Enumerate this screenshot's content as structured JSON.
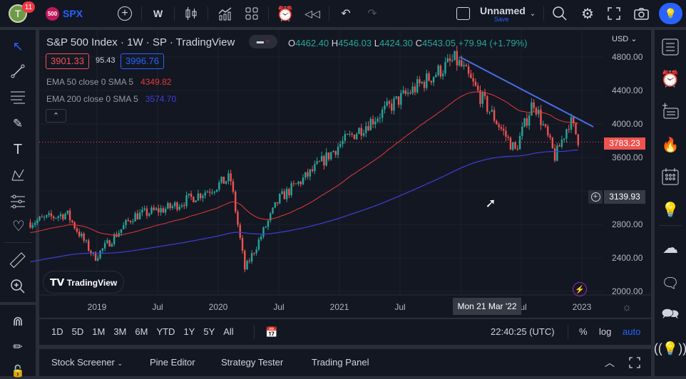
{
  "topbar": {
    "avatar_letter": "T",
    "notifications": "11",
    "symbol_badge": "500",
    "symbol": "SPX",
    "interval": "W",
    "layout_name": "Unnamed",
    "save_label": "Save"
  },
  "legend": {
    "title": "S&P 500 Index · 1W · SP  · TradingView",
    "o_label": "O",
    "open": "4462.40",
    "h_label": "H",
    "high": "4546.03",
    "l_label": "L",
    "low": "4424.30",
    "c_label": "C",
    "close": "4543.05",
    "change": "+79.94 (+1.79%)",
    "bid": "3901.33",
    "spread": "95.43",
    "ask": "3996.76",
    "ema50_label": "EMA 50 close 0 SMA 5",
    "ema50_value": "4349.82",
    "ema200_label": "EMA 200 close 0 SMA 5",
    "ema200_value": "3574.70"
  },
  "price_axis": {
    "currency": "USD",
    "ticks": [
      "4800.00",
      "4400.00",
      "4000.00",
      "3600.00",
      "2800.00",
      "2400.00",
      "2000.00"
    ],
    "last_price": "3783.23",
    "crosshair_price": "3139.93"
  },
  "time_axis": {
    "ticks": [
      "2019",
      "Jul",
      "2020",
      "Jul",
      "2021",
      "Jul",
      "Jul",
      "2023"
    ],
    "crosshair_date": "Mon 21 Mar '22"
  },
  "watermark": "TradingView",
  "range_bar": {
    "ranges": [
      "1D",
      "5D",
      "1M",
      "3M",
      "6M",
      "YTD",
      "1Y",
      "5Y",
      "All"
    ],
    "clock": "22:40:25 (UTC)",
    "percent": "%",
    "log": "log",
    "auto": "auto"
  },
  "bottom_tabs": [
    "Stock Screener",
    "Pine Editor",
    "Strategy Tester",
    "Trading Panel"
  ],
  "colors": {
    "up": "#26a69a",
    "down": "#ef5350",
    "ema50": "#e53935",
    "ema200": "#3f3fd6",
    "trend": "#4a6ee0",
    "accent": "#2962ff"
  },
  "chart_data": {
    "type": "candlestick",
    "anchors": [
      [
        2018.45,
        2825
      ],
      [
        2018.75,
        2930
      ],
      [
        2018.98,
        2400
      ],
      [
        2019.3,
        2900
      ],
      [
        2019.6,
        3000
      ],
      [
        2019.95,
        3230
      ],
      [
        2020.1,
        3360
      ],
      [
        2020.22,
        2260
      ],
      [
        2020.5,
        3100
      ],
      [
        2020.75,
        3400
      ],
      [
        2021.0,
        3750
      ],
      [
        2021.5,
        4300
      ],
      [
        2021.95,
        4766
      ],
      [
        2022.0,
        4700
      ],
      [
        2022.45,
        3680
      ],
      [
        2022.6,
        4280
      ],
      [
        2022.78,
        3600
      ],
      [
        2022.9,
        4050
      ],
      [
        2022.98,
        3783
      ]
    ]
  }
}
